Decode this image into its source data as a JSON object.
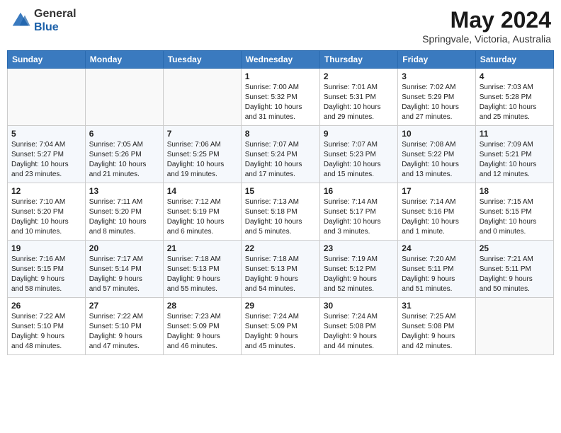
{
  "header": {
    "logo_general": "General",
    "logo_blue": "Blue",
    "month_title": "May 2024",
    "location": "Springvale, Victoria, Australia"
  },
  "weekdays": [
    "Sunday",
    "Monday",
    "Tuesday",
    "Wednesday",
    "Thursday",
    "Friday",
    "Saturday"
  ],
  "weeks": [
    [
      {
        "day": "",
        "info": ""
      },
      {
        "day": "",
        "info": ""
      },
      {
        "day": "",
        "info": ""
      },
      {
        "day": "1",
        "info": "Sunrise: 7:00 AM\nSunset: 5:32 PM\nDaylight: 10 hours\nand 31 minutes."
      },
      {
        "day": "2",
        "info": "Sunrise: 7:01 AM\nSunset: 5:31 PM\nDaylight: 10 hours\nand 29 minutes."
      },
      {
        "day": "3",
        "info": "Sunrise: 7:02 AM\nSunset: 5:29 PM\nDaylight: 10 hours\nand 27 minutes."
      },
      {
        "day": "4",
        "info": "Sunrise: 7:03 AM\nSunset: 5:28 PM\nDaylight: 10 hours\nand 25 minutes."
      }
    ],
    [
      {
        "day": "5",
        "info": "Sunrise: 7:04 AM\nSunset: 5:27 PM\nDaylight: 10 hours\nand 23 minutes."
      },
      {
        "day": "6",
        "info": "Sunrise: 7:05 AM\nSunset: 5:26 PM\nDaylight: 10 hours\nand 21 minutes."
      },
      {
        "day": "7",
        "info": "Sunrise: 7:06 AM\nSunset: 5:25 PM\nDaylight: 10 hours\nand 19 minutes."
      },
      {
        "day": "8",
        "info": "Sunrise: 7:07 AM\nSunset: 5:24 PM\nDaylight: 10 hours\nand 17 minutes."
      },
      {
        "day": "9",
        "info": "Sunrise: 7:07 AM\nSunset: 5:23 PM\nDaylight: 10 hours\nand 15 minutes."
      },
      {
        "day": "10",
        "info": "Sunrise: 7:08 AM\nSunset: 5:22 PM\nDaylight: 10 hours\nand 13 minutes."
      },
      {
        "day": "11",
        "info": "Sunrise: 7:09 AM\nSunset: 5:21 PM\nDaylight: 10 hours\nand 12 minutes."
      }
    ],
    [
      {
        "day": "12",
        "info": "Sunrise: 7:10 AM\nSunset: 5:20 PM\nDaylight: 10 hours\nand 10 minutes."
      },
      {
        "day": "13",
        "info": "Sunrise: 7:11 AM\nSunset: 5:20 PM\nDaylight: 10 hours\nand 8 minutes."
      },
      {
        "day": "14",
        "info": "Sunrise: 7:12 AM\nSunset: 5:19 PM\nDaylight: 10 hours\nand 6 minutes."
      },
      {
        "day": "15",
        "info": "Sunrise: 7:13 AM\nSunset: 5:18 PM\nDaylight: 10 hours\nand 5 minutes."
      },
      {
        "day": "16",
        "info": "Sunrise: 7:14 AM\nSunset: 5:17 PM\nDaylight: 10 hours\nand 3 minutes."
      },
      {
        "day": "17",
        "info": "Sunrise: 7:14 AM\nSunset: 5:16 PM\nDaylight: 10 hours\nand 1 minute."
      },
      {
        "day": "18",
        "info": "Sunrise: 7:15 AM\nSunset: 5:15 PM\nDaylight: 10 hours\nand 0 minutes."
      }
    ],
    [
      {
        "day": "19",
        "info": "Sunrise: 7:16 AM\nSunset: 5:15 PM\nDaylight: 9 hours\nand 58 minutes."
      },
      {
        "day": "20",
        "info": "Sunrise: 7:17 AM\nSunset: 5:14 PM\nDaylight: 9 hours\nand 57 minutes."
      },
      {
        "day": "21",
        "info": "Sunrise: 7:18 AM\nSunset: 5:13 PM\nDaylight: 9 hours\nand 55 minutes."
      },
      {
        "day": "22",
        "info": "Sunrise: 7:18 AM\nSunset: 5:13 PM\nDaylight: 9 hours\nand 54 minutes."
      },
      {
        "day": "23",
        "info": "Sunrise: 7:19 AM\nSunset: 5:12 PM\nDaylight: 9 hours\nand 52 minutes."
      },
      {
        "day": "24",
        "info": "Sunrise: 7:20 AM\nSunset: 5:11 PM\nDaylight: 9 hours\nand 51 minutes."
      },
      {
        "day": "25",
        "info": "Sunrise: 7:21 AM\nSunset: 5:11 PM\nDaylight: 9 hours\nand 50 minutes."
      }
    ],
    [
      {
        "day": "26",
        "info": "Sunrise: 7:22 AM\nSunset: 5:10 PM\nDaylight: 9 hours\nand 48 minutes."
      },
      {
        "day": "27",
        "info": "Sunrise: 7:22 AM\nSunset: 5:10 PM\nDaylight: 9 hours\nand 47 minutes."
      },
      {
        "day": "28",
        "info": "Sunrise: 7:23 AM\nSunset: 5:09 PM\nDaylight: 9 hours\nand 46 minutes."
      },
      {
        "day": "29",
        "info": "Sunrise: 7:24 AM\nSunset: 5:09 PM\nDaylight: 9 hours\nand 45 minutes."
      },
      {
        "day": "30",
        "info": "Sunrise: 7:24 AM\nSunset: 5:08 PM\nDaylight: 9 hours\nand 44 minutes."
      },
      {
        "day": "31",
        "info": "Sunrise: 7:25 AM\nSunset: 5:08 PM\nDaylight: 9 hours\nand 42 minutes."
      },
      {
        "day": "",
        "info": ""
      }
    ]
  ]
}
